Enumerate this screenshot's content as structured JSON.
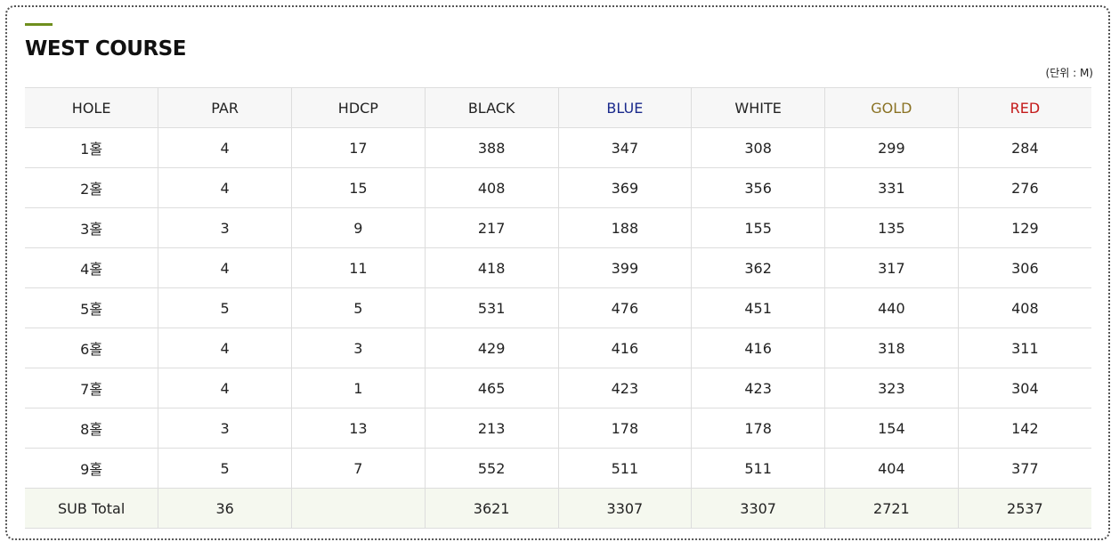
{
  "course": {
    "title": "WEST COURSE",
    "unit_note": "(단위 : M)",
    "accent_color": "#6f8f1e"
  },
  "table": {
    "columns": [
      {
        "label": "HOLE",
        "color": "#222222"
      },
      {
        "label": "PAR",
        "color": "#222222"
      },
      {
        "label": "HDCP",
        "color": "#222222"
      },
      {
        "label": "BLACK",
        "color": "#222222"
      },
      {
        "label": "BLUE",
        "color": "#1a2a8c"
      },
      {
        "label": "WHITE",
        "color": "#222222"
      },
      {
        "label": "GOLD",
        "color": "#8a7224"
      },
      {
        "label": "RED",
        "color": "#c41a1a"
      }
    ],
    "rows": [
      [
        "1홀",
        "4",
        "17",
        "388",
        "347",
        "308",
        "299",
        "284"
      ],
      [
        "2홀",
        "4",
        "15",
        "408",
        "369",
        "356",
        "331",
        "276"
      ],
      [
        "3홀",
        "3",
        "9",
        "217",
        "188",
        "155",
        "135",
        "129"
      ],
      [
        "4홀",
        "4",
        "11",
        "418",
        "399",
        "362",
        "317",
        "306"
      ],
      [
        "5홀",
        "5",
        "5",
        "531",
        "476",
        "451",
        "440",
        "408"
      ],
      [
        "6홀",
        "4",
        "3",
        "429",
        "416",
        "416",
        "318",
        "311"
      ],
      [
        "7홀",
        "4",
        "1",
        "465",
        "423",
        "423",
        "323",
        "304"
      ],
      [
        "8홀",
        "3",
        "13",
        "213",
        "178",
        "178",
        "154",
        "142"
      ],
      [
        "9홀",
        "5",
        "7",
        "552",
        "511",
        "511",
        "404",
        "377"
      ]
    ],
    "subtotal": [
      "SUB Total",
      "36",
      "",
      "3621",
      "3307",
      "3307",
      "2721",
      "2537"
    ]
  }
}
